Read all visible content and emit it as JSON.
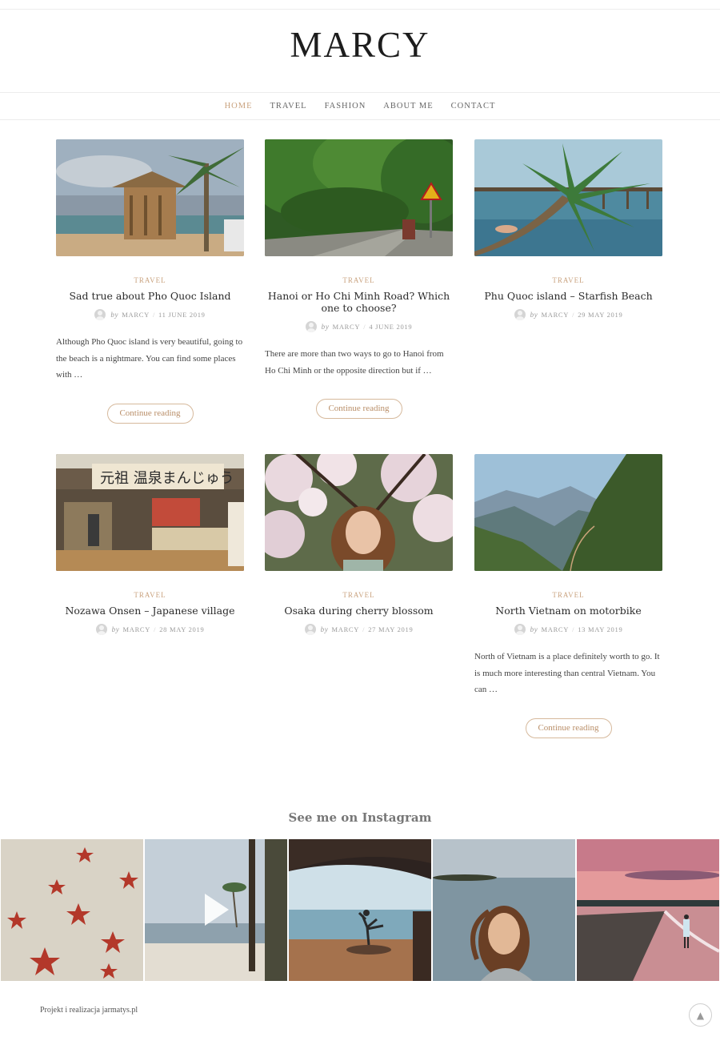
{
  "site": {
    "logo": "MARCY"
  },
  "nav": {
    "items": [
      {
        "label": "HOME",
        "active": true
      },
      {
        "label": "TRAVEL",
        "active": false
      },
      {
        "label": "FASHION",
        "active": false
      },
      {
        "label": "ABOUT ME",
        "active": false
      },
      {
        "label": "CONTACT",
        "active": false
      }
    ]
  },
  "posts": [
    {
      "category": "TRAVEL",
      "title": "Sad true about Pho Quoc Island",
      "by": "by",
      "author": "MARCY",
      "date": "11 JUNE 2019",
      "excerpt": "Although Pho Quoc island is very beautiful, going to the beach is a nightmare. You can find some places with …",
      "button": "Continue reading"
    },
    {
      "category": "TRAVEL",
      "title": "Hanoi or Ho Chi Minh Road? Which one to choose?",
      "by": "by",
      "author": "MARCY",
      "date": "4 JUNE 2019",
      "excerpt": "There are more than two ways to go to Hanoi from Ho Chi Minh or the opposite direction but if …",
      "button": "Continue reading"
    },
    {
      "category": "TRAVEL",
      "title": "Phu Quoc island – Starfish Beach",
      "by": "by",
      "author": "MARCY",
      "date": "29 MAY 2019"
    },
    {
      "category": "TRAVEL",
      "title": "Nozawa Onsen – Japanese village",
      "by": "by",
      "author": "MARCY",
      "date": "28 MAY 2019"
    },
    {
      "category": "TRAVEL",
      "title": "Osaka during cherry blossom",
      "by": "by",
      "author": "MARCY",
      "date": "27 MAY 2019"
    },
    {
      "category": "TRAVEL",
      "title": "North Vietnam on motorbike",
      "by": "by",
      "author": "MARCY",
      "date": "13 MAY 2019",
      "excerpt": "North of Vietnam is a place definitely worth to go. It is much more interesting than central Vietnam. You can …",
      "button": "Continue reading"
    }
  ],
  "instagram": {
    "title": "See me on Instagram"
  },
  "footer": {
    "credit": "Projekt i realizacja jarmatys.pl",
    "to_top_icon": "▲"
  }
}
